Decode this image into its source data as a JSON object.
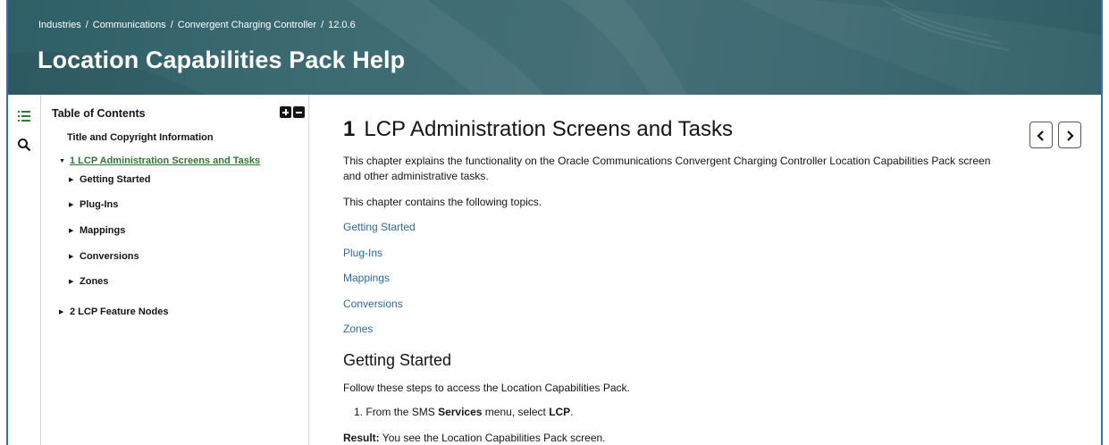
{
  "breadcrumb": {
    "items": [
      "Industries",
      "Communications",
      "Convergent Charging Controller",
      "12.0.6"
    ],
    "separator": "/"
  },
  "header": {
    "title": "Location Capabilities Pack Help"
  },
  "rail": {
    "icons": [
      "list-icon",
      "search-icon"
    ]
  },
  "toc": {
    "heading": "Table of Contents",
    "tools": [
      "expand-all-icon",
      "collapse-all-icon"
    ],
    "items": [
      {
        "label": "Title and Copyright Information"
      },
      {
        "label": "1 LCP Administration Screens and Tasks"
      },
      {
        "label": "Getting Started"
      },
      {
        "label": "Plug-Ins"
      },
      {
        "label": "Mappings"
      },
      {
        "label": "Conversions"
      },
      {
        "label": "Zones"
      },
      {
        "label": "2 LCP Feature Nodes"
      }
    ]
  },
  "content": {
    "chapter_num": "1",
    "chapter_title": "LCP Administration Screens and Tasks",
    "intro": "This chapter explains the functionality on the Oracle Communications Convergent Charging Controller Location Capabilities Pack screen and other administrative tasks.",
    "topics_intro": "This chapter contains the following topics.",
    "links": [
      "Getting Started",
      "Plug-Ins",
      "Mappings",
      "Conversions",
      "Zones"
    ],
    "section_heading": "Getting Started",
    "section_intro": "Follow these steps to access the Location Capabilities Pack.",
    "step": {
      "num": "1.",
      "pre": "From the SMS",
      "bold1": "Services",
      "mid": "menu, select",
      "bold2": "LCP",
      "post": "."
    },
    "result": {
      "label": "Result:",
      "text": "You see the Location Capabilities Pack screen."
    }
  },
  "nav": {
    "prev": "chevron-left-icon",
    "next": "chevron-right-icon"
  },
  "colors": {
    "header_bg": "#3c6b72",
    "link": "#2b6a9e",
    "active_toc": "#2a7a36",
    "frame": "#3a6fb0"
  }
}
